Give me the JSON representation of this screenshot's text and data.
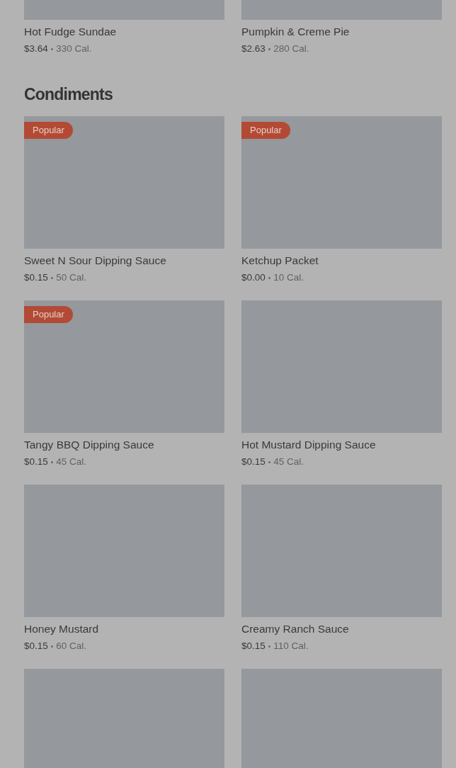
{
  "separator": "•",
  "sections": [
    {
      "items": [
        {
          "kind": "item",
          "name": "Hot Fudge Sundae",
          "price": "$3.64",
          "calories": "330 Cal."
        },
        {
          "kind": "item",
          "name": "Pumpkin & Creme Pie",
          "price": "$2.63",
          "calories": "280 Cal."
        }
      ]
    },
    {
      "title": "Condiments",
      "items": [
        {
          "kind": "item",
          "name": "Sweet N Sour Dipping Sauce",
          "price": "$0.15",
          "calories": "50 Cal.",
          "badge": "Popular"
        },
        {
          "kind": "item",
          "name": "Ketchup Packet",
          "price": "$0.00",
          "calories": "10 Cal.",
          "badge": "Popular"
        },
        {
          "kind": "item",
          "name": "Tangy BBQ Dipping Sauce",
          "price": "$0.15",
          "calories": "45 Cal.",
          "badge": "Popular"
        },
        {
          "kind": "item",
          "name": "Hot Mustard Dipping Sauce",
          "price": "$0.15",
          "calories": "45 Cal."
        },
        {
          "kind": "item",
          "name": "Honey Mustard",
          "price": "$0.15",
          "calories": "60 Cal."
        },
        {
          "kind": "item",
          "name": "Creamy Ranch Sauce",
          "price": "$0.15",
          "calories": "110 Cal."
        },
        {
          "kind": "picture"
        },
        {
          "kind": "picture"
        }
      ]
    }
  ]
}
